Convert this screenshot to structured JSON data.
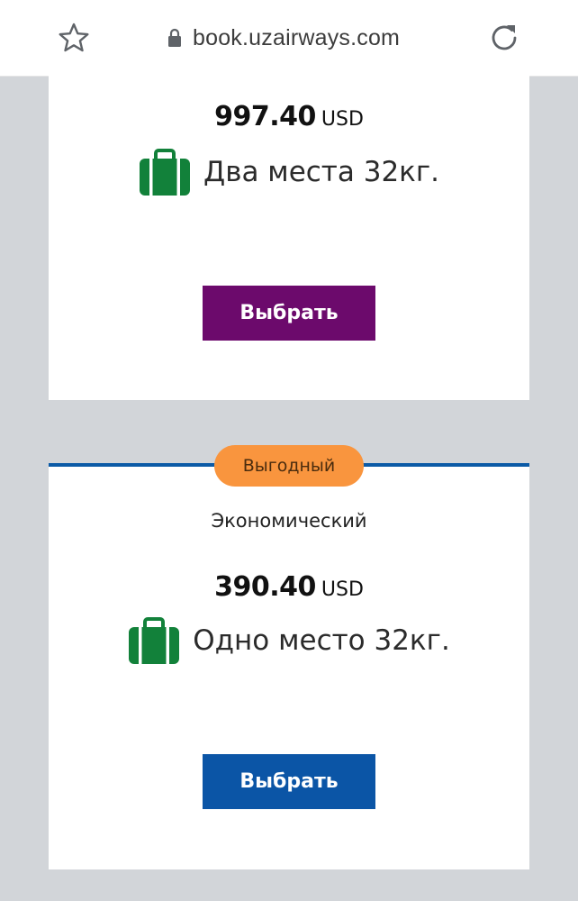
{
  "browser": {
    "url": "book.uzairways.com",
    "icons": [
      "star-icon",
      "lock-icon",
      "reload-icon"
    ]
  },
  "fares": [
    {
      "price": "997.40",
      "currency": "USD",
      "baggage": "Два места 32кг.",
      "select_label": "Выбрать",
      "button_color": "#6c0a6c"
    },
    {
      "badge": "Выгодный",
      "fare_class": "Экономический",
      "price": "390.40",
      "currency": "USD",
      "baggage": "Одно место 32кг.",
      "select_label": "Выбрать",
      "button_color": "#0b55a6",
      "accent_color": "#0b5aa6",
      "badge_color": "#f9953e"
    }
  ],
  "colors": {
    "page_background": "#d2d5d9",
    "suitcase_green": "#12813a"
  }
}
